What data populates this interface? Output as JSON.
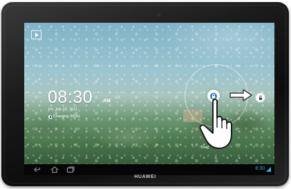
{
  "device": {
    "brand": "HUAWEI"
  },
  "lockscreen": {
    "time": "08:30",
    "ampm": "AM",
    "date": "Fri, July 22, 2011",
    "charging": "Charging (65%)",
    "drag_hint": "Drag"
  },
  "statusbar": {
    "clock": "8:30"
  },
  "icons": {
    "media": "play-icon",
    "lock": "lock-icon",
    "unlock_target": "unlock-icon",
    "gesture": "hand-pointer-icon",
    "direction": "arrow-right-icon",
    "back": "back-icon",
    "home": "home-icon",
    "recent": "recent-apps-icon",
    "signal": "signal-icon"
  },
  "colors": {
    "accent": "#33b5e5",
    "lock_blue": "#2f7fd1"
  }
}
